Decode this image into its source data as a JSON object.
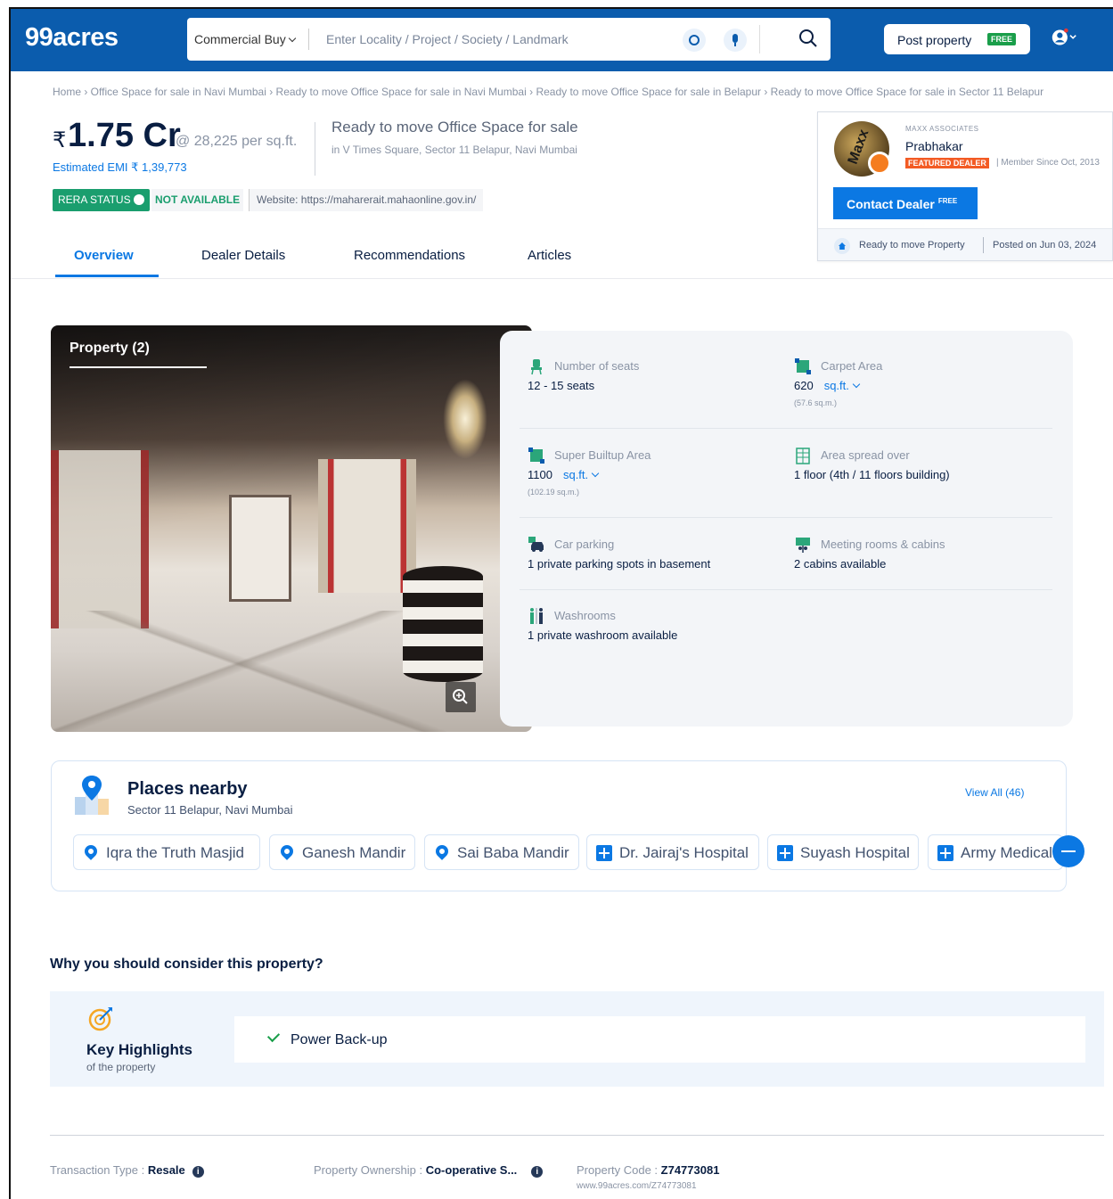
{
  "header": {
    "logo": "99acres",
    "search_type": "Commercial Buy",
    "search_placeholder": "Enter Locality / Project / Society / Landmark",
    "post_property_label": "Post property",
    "post_property_badge": "FREE"
  },
  "breadcrumb": "Home › Office Space for sale in Navi Mumbai › Ready to move Office Space for sale in Navi Mumbai › Ready to move Office Space for sale in Belapur › Ready to move Office Space for sale in Sector 11 Belapur",
  "listing": {
    "currency": "₹",
    "price": "1.75 Cr",
    "price_per_sqft": "@ 28,225 per sq.ft.",
    "emi": "Estimated EMI ₹ 1,39,773",
    "title": "Ready to move Office Space for sale",
    "address": "in V Times Square, Sector 11 Belapur, Navi Mumbai",
    "rera_label": "RERA STATUS",
    "rera_value": "NOT AVAILABLE",
    "rera_website": "Website: https://maharerait.mahaonline.gov.in/"
  },
  "tabs": [
    "Overview",
    "Dealer Details",
    "Recommendations",
    "Articles"
  ],
  "dealer": {
    "company": "MAXX ASSOCIATES",
    "name": "Prabhakar",
    "badge": "FEATURED DEALER",
    "member_since": "| Member Since Oct, 2013",
    "contact_label": "Contact Dealer",
    "contact_badge": "FREE",
    "status": "Ready to move Property",
    "posted": "Posted on Jun 03, 2024"
  },
  "gallery": {
    "caption": "Property (2)"
  },
  "facts": {
    "seats_label": "Number of seats",
    "seats_value": "12 - 15 seats",
    "carpet_label": "Carpet Area",
    "carpet_value": "620",
    "carpet_unit": "sq.ft.",
    "carpet_sub": "(57.6 sq.m.)",
    "builtup_label": "Super Builtup Area",
    "builtup_value": "1100",
    "builtup_unit": "sq.ft.",
    "builtup_sub": "(102.19 sq.m.)",
    "floors_label": "Area spread over",
    "floors_value": "1 floor (4th / 11 floors building)",
    "parking_label": "Car parking",
    "parking_value": "1 private parking spots in basement",
    "meeting_label": "Meeting rooms & cabins",
    "meeting_value": "2 cabins available",
    "washroom_label": "Washrooms",
    "washroom_value": "1 private washroom available"
  },
  "places": {
    "title": "Places nearby",
    "subtitle": "Sector 11 Belapur, Navi Mumbai",
    "view_all": "View All (46)",
    "items": [
      {
        "name": "Iqra the Truth Masjid",
        "icon": "location-pin-icon"
      },
      {
        "name": "Ganesh Mandir",
        "icon": "location-pin-icon"
      },
      {
        "name": "Sai Baba Mandir",
        "icon": "location-pin-icon"
      },
      {
        "name": "Dr. Jairaj's Hospital",
        "icon": "hospital-icon"
      },
      {
        "name": "Suyash Hospital",
        "icon": "hospital-icon"
      },
      {
        "name": "Army Medical",
        "icon": "hospital-icon"
      }
    ]
  },
  "highlights": {
    "question": "Why you should consider this property?",
    "title": "Key Highlights",
    "subtitle": "of the property",
    "items": [
      "Power Back-up"
    ]
  },
  "footer": {
    "transaction_label": "Transaction Type : ",
    "transaction_value": "Resale",
    "ownership_label": "Property Ownership : ",
    "ownership_value": "Co-operative S...",
    "code_label": "Property Code : ",
    "code_value": "Z74773081",
    "code_url": "www.99acres.com/Z74773081"
  },
  "colors": {
    "brand_blue": "#0B5CAD",
    "link_blue": "#0B78E3",
    "rera_green": "#1A9E6E",
    "featured_orange": "#F35B24"
  }
}
